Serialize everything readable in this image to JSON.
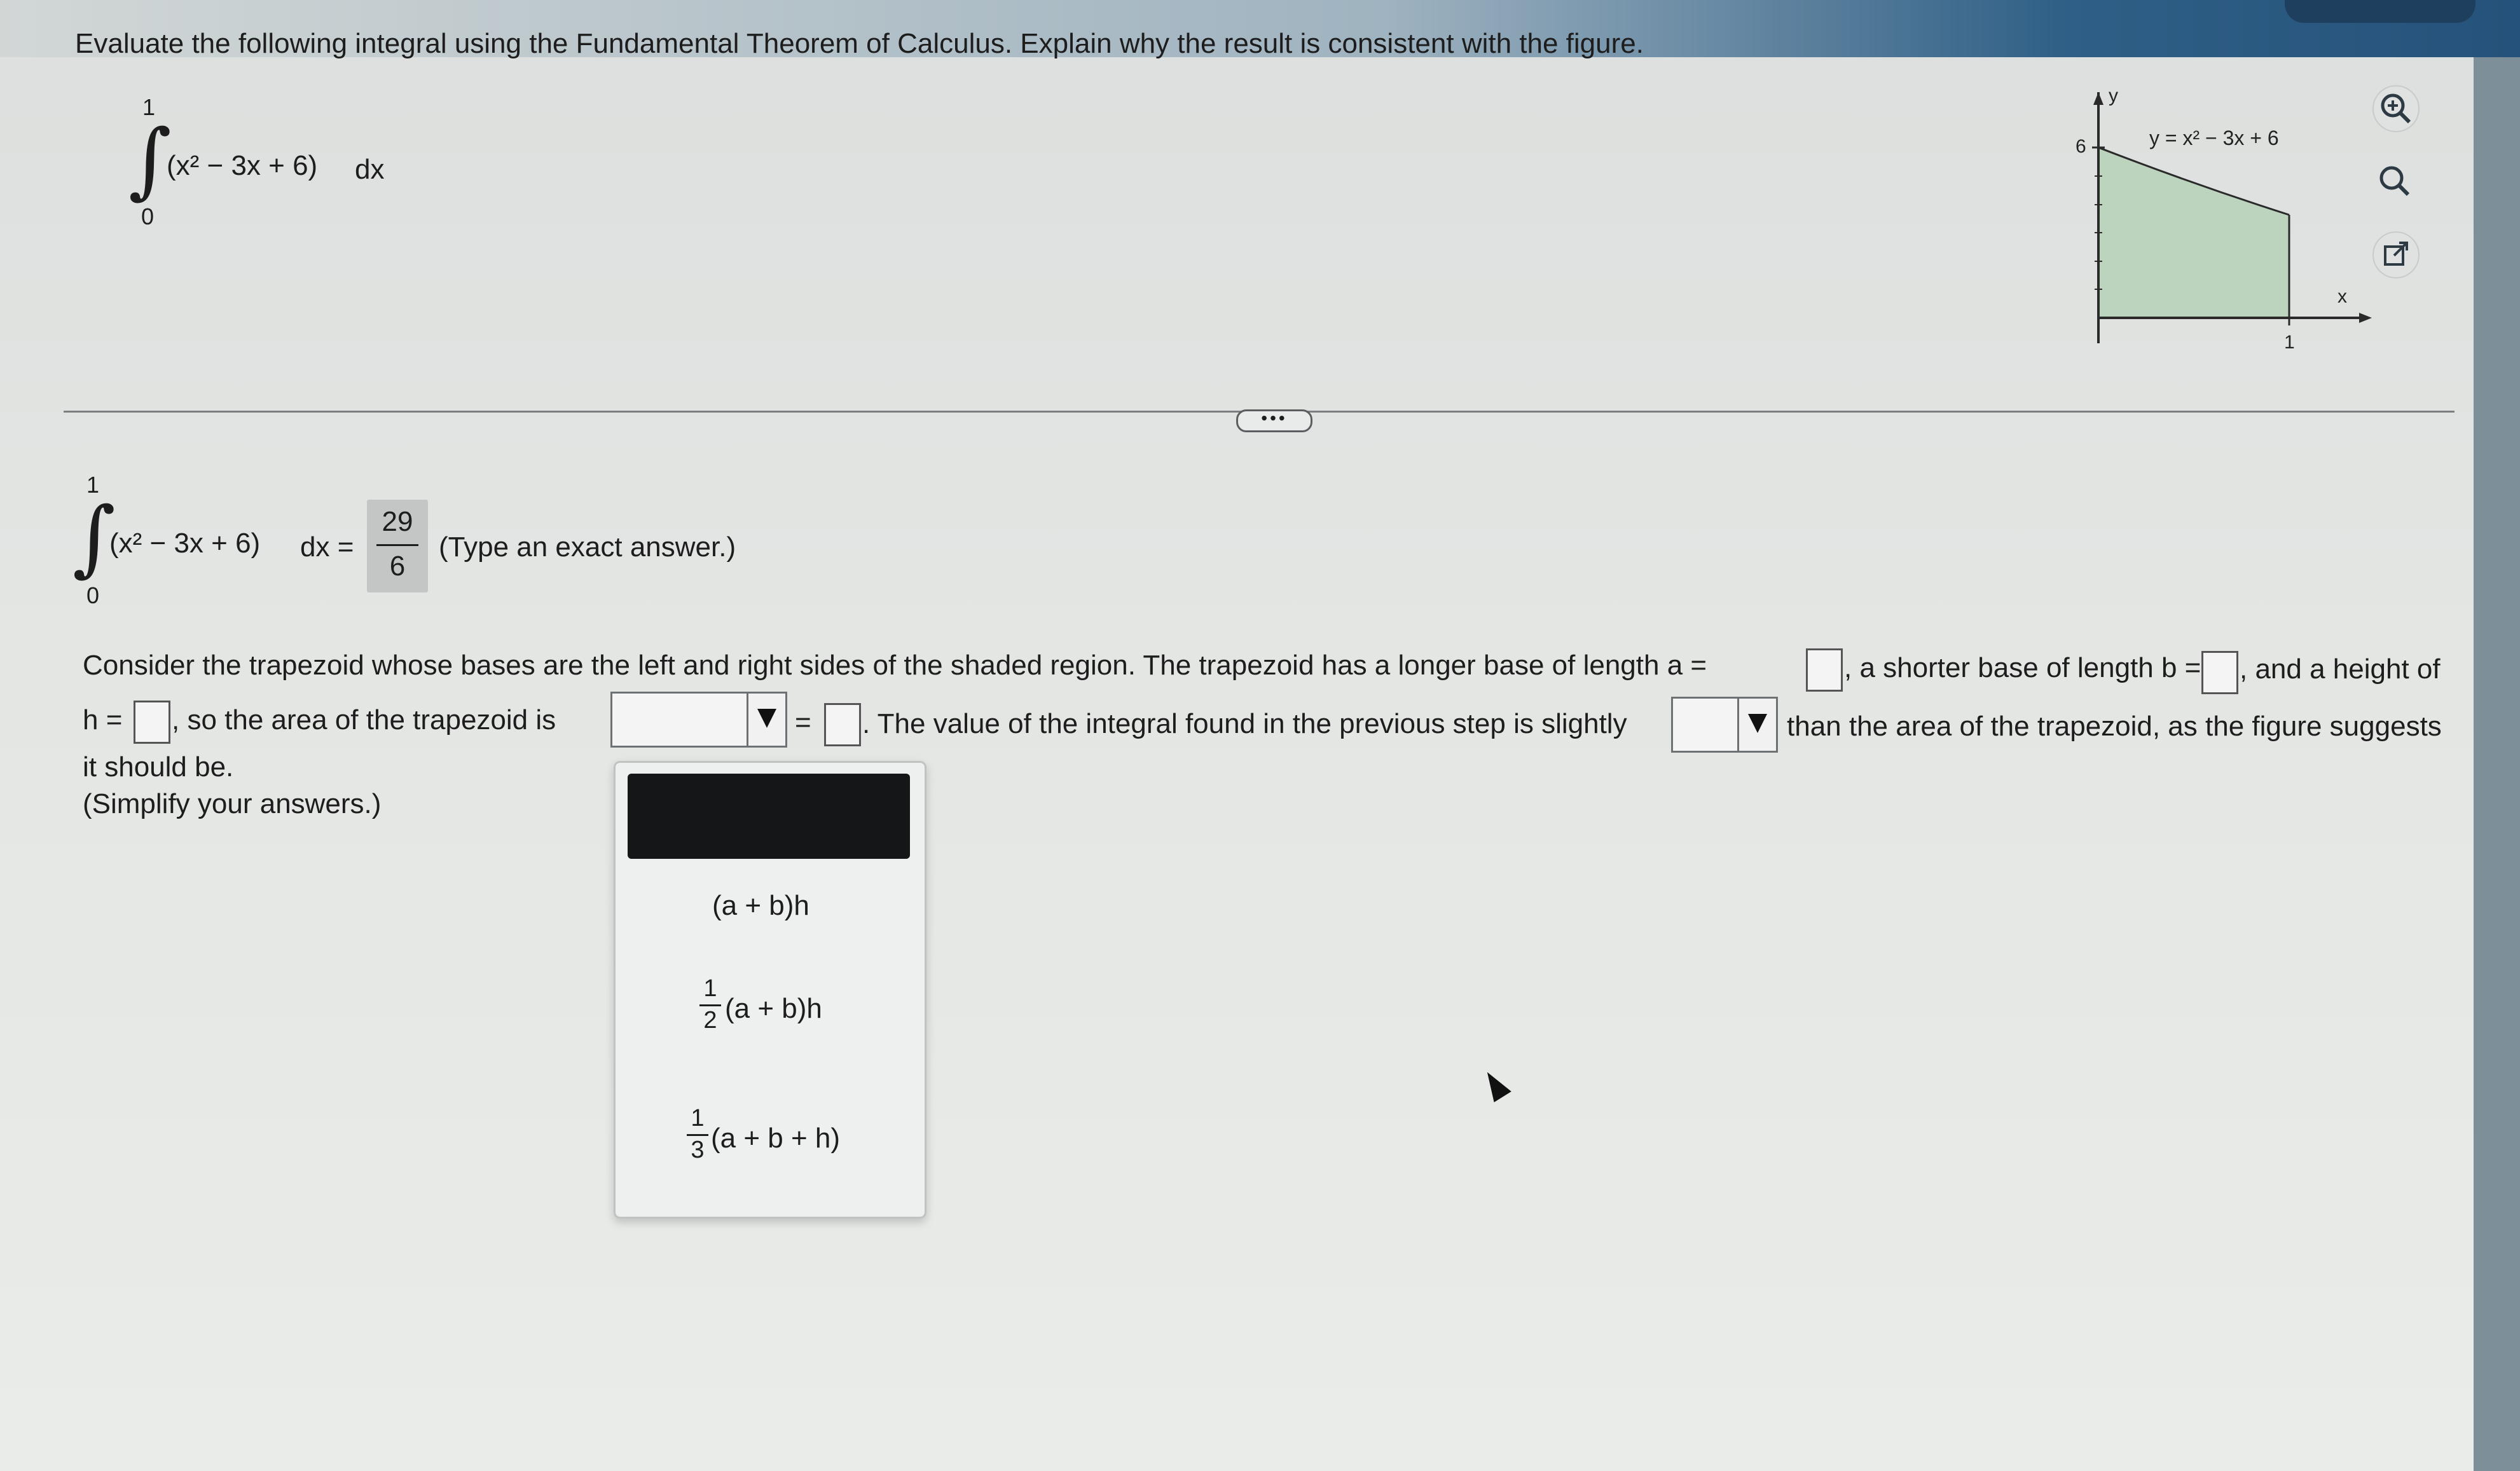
{
  "question": {
    "prompt": "Evaluate the following integral using the Fundamental Theorem of Calculus. Explain why the result is consistent with the figure.",
    "integral": {
      "upper": "1",
      "lower": "0",
      "integrand": "(x² − 3x + 6)",
      "differential": "dx"
    }
  },
  "graph": {
    "y_axis_label": "y",
    "x_axis_label": "x",
    "y_tick": "6",
    "x_tick": "1",
    "curve_label": "y = x² − 3x + 6",
    "fill_color": "#bcd4be",
    "curve_color": "#2a2a2a"
  },
  "tools": {
    "zoom_in": "zoom-in-icon",
    "zoom_out": "zoom-out-icon",
    "popout": "popout-icon"
  },
  "divider": {
    "expand_label": "•••"
  },
  "answer": {
    "upper": "1",
    "lower": "0",
    "integrand": "(x² − 3x + 6)",
    "lhs_suffix": "dx =",
    "numerator": "29",
    "denominator": "6",
    "hint": "(Type an exact answer.)"
  },
  "trapezoid": {
    "line1_a": "Consider the trapezoid whose bases are the left and right sides of the shaded region. The trapezoid has a longer base of length a =",
    "line1_b": ", a shorter base of length b =",
    "line1_c": ", and a height of",
    "line2_a": "h =",
    "line2_b": ", so the area of the trapezoid is",
    "line2_eq": "=",
    "line2_c": ". The value of the integral found in the previous step is slightly",
    "line2_d": "than the area of the trapezoid, as the figure suggests",
    "line3": "it should be.",
    "line4": "(Simplify your answers.)"
  },
  "menu": {
    "option1": "(a + b)h",
    "option2_num": "1",
    "option2_den": "2",
    "option2_expr": "(a + b)h",
    "option3_num": "1",
    "option3_den": "3",
    "option3_expr": "(a + b + h)"
  }
}
